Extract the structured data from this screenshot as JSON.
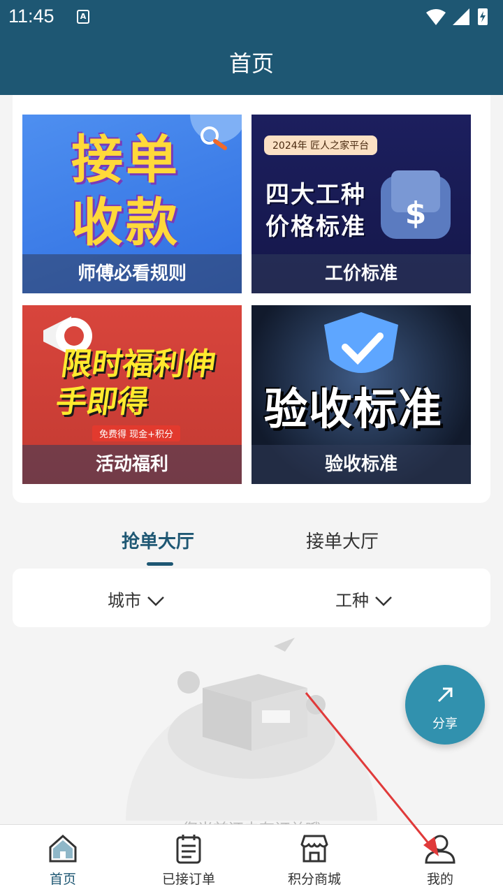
{
  "status_bar": {
    "time": "11:45",
    "app_icon_letter": "A",
    "icons": [
      "wifi-icon",
      "signal-icon",
      "battery-icon"
    ]
  },
  "header": {
    "title": "首页"
  },
  "cards": [
    {
      "title_big": "接单收款",
      "caption": "师傅必看规则"
    },
    {
      "badge": "2024年 匠人之家平台",
      "title_big": "四大工种价格标准",
      "caption": "工价标准"
    },
    {
      "title_big": "限时福利伸手即得",
      "subtitle": "免费得 现金+积分",
      "caption": "活动福利"
    },
    {
      "title_big": "验收标准",
      "caption": "验收标准"
    }
  ],
  "tabs": [
    {
      "label": "抢单大厅",
      "active": true
    },
    {
      "label": "接单大厅",
      "active": false
    }
  ],
  "filters": [
    {
      "label": "城市"
    },
    {
      "label": "工种"
    }
  ],
  "empty_state": {
    "text": "您当前还未有订单哦"
  },
  "fab": {
    "label": "分享"
  },
  "bottom_nav": [
    {
      "label": "首页",
      "icon": "home-icon",
      "active": true
    },
    {
      "label": "已接订单",
      "icon": "orders-icon",
      "active": false
    },
    {
      "label": "积分商城",
      "icon": "store-icon",
      "active": false
    },
    {
      "label": "我的",
      "icon": "profile-icon",
      "active": false
    }
  ],
  "colors": {
    "primary": "#1e5773",
    "fab": "#3191ae",
    "annotation_arrow": "#e03a3a"
  }
}
